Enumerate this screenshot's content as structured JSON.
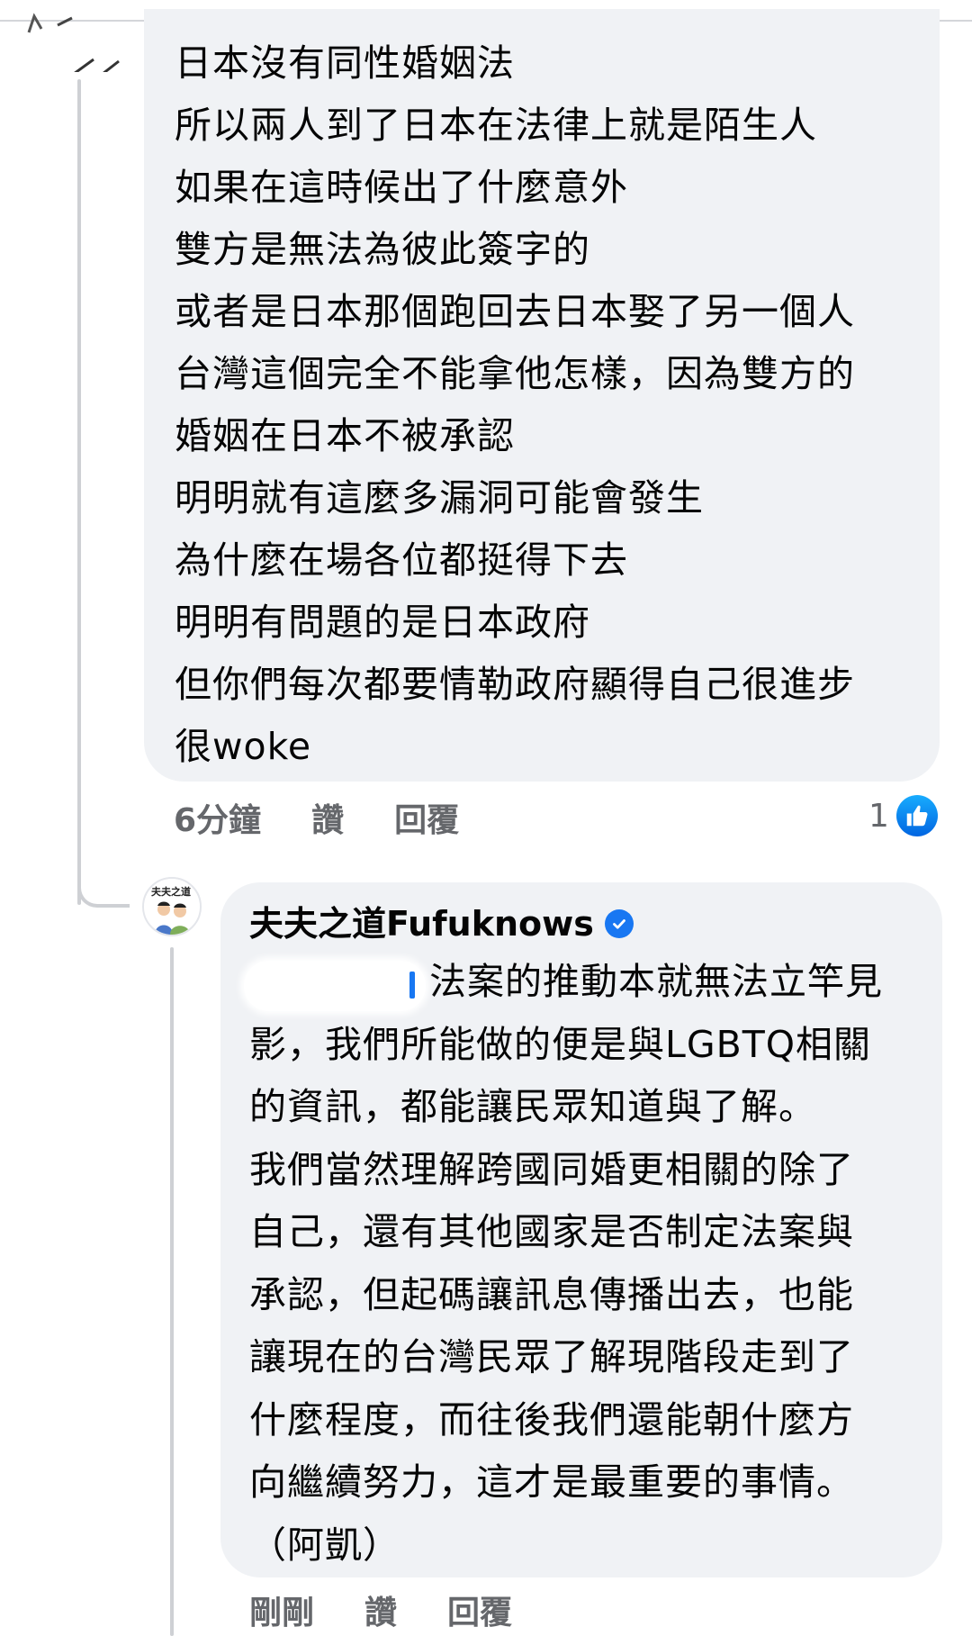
{
  "comment_1": {
    "lines": [
      "日本沒有同性婚姻法",
      "所以兩人到了日本在法律上就是陌生人",
      "如果在這時候出了什麼意外",
      "雙方是無法為彼此簽字的",
      "或者是日本那個跑回去日本娶了另一個人",
      "台灣這個完全不能拿他怎樣，因為雙方的",
      "婚姻在日本不被承認",
      "明明就有這麼多漏洞可能會發生",
      "為什麼在場各位都挺得下去",
      "明明有問題的是日本政府",
      "但你們每次都要情勒政府顯得自己很進步",
      "很woke"
    ],
    "time": "6分鐘",
    "like_label": "讚",
    "reply_label": "回覆",
    "reaction_count": "1",
    "reaction_icon": "like-icon"
  },
  "comment_2": {
    "author": "夫夫之道Fufuknows",
    "verified_icon": "verified-icon",
    "avatar_text": "夫夫之道",
    "lines": [
      "法案的推動本就無法立竿見",
      "影，我們所能做的便是與LGBTQ相關",
      "的資訊，都能讓民眾知道與了解。",
      "我們當然理解跨國同婚更相關的除了",
      "自己，還有其他國家是否制定法案與",
      "承認，但起碼讓訊息傳播出去，也能",
      "讓現在的台灣民眾了解現階段走到了",
      "什麼程度，而往後我們還能朝什麼方",
      "向繼續努力，這才是最重要的事情。",
      "（阿凱）"
    ],
    "time": "剛剛",
    "like_label": "讚",
    "reply_label": "回覆"
  },
  "colors": {
    "bubble_bg": "#f0f2f5",
    "meta_text": "#65676b",
    "thread_line": "#ced0d4",
    "facebook_blue": "#1877f2"
  }
}
